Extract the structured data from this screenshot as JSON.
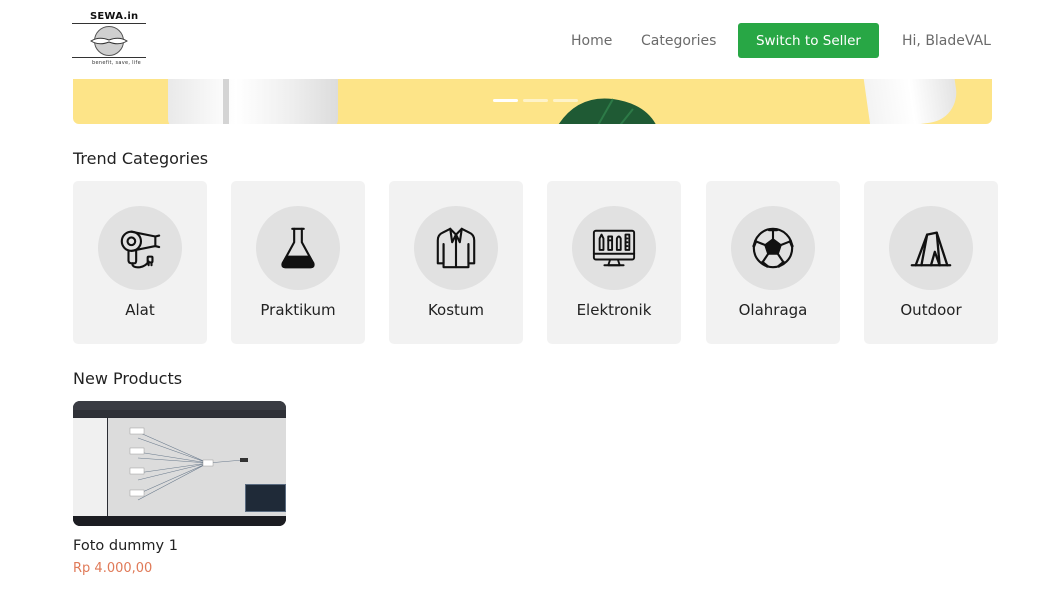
{
  "header": {
    "logo_text": "SEWA.in",
    "logo_tagline": "benefit, save, life",
    "nav": {
      "home": "Home",
      "categories": "Categories",
      "switch_seller": "Switch to Seller",
      "greeting": "Hi, BladeVAL"
    }
  },
  "banner": {
    "slides_count": 3,
    "active_slide": 1
  },
  "trend": {
    "title": "Trend Categories",
    "categories": [
      {
        "label": "Alat",
        "icon": "hair-dryer-icon"
      },
      {
        "label": "Praktikum",
        "icon": "flask-icon"
      },
      {
        "label": "Kostum",
        "icon": "jacket-icon"
      },
      {
        "label": "Elektronik",
        "icon": "monitor-design-icon"
      },
      {
        "label": "Olahraga",
        "icon": "soccer-ball-icon"
      },
      {
        "label": "Outdoor",
        "icon": "tent-icon"
      }
    ]
  },
  "new_products": {
    "title": "New Products",
    "items": [
      {
        "name": "Foto dummy 1",
        "price": "Rp 4.000,00"
      }
    ]
  },
  "colors": {
    "accent_green": "#28a745",
    "banner_yellow": "#fde488",
    "price_orange": "#e07a58",
    "card_bg": "#f2f2f2"
  }
}
